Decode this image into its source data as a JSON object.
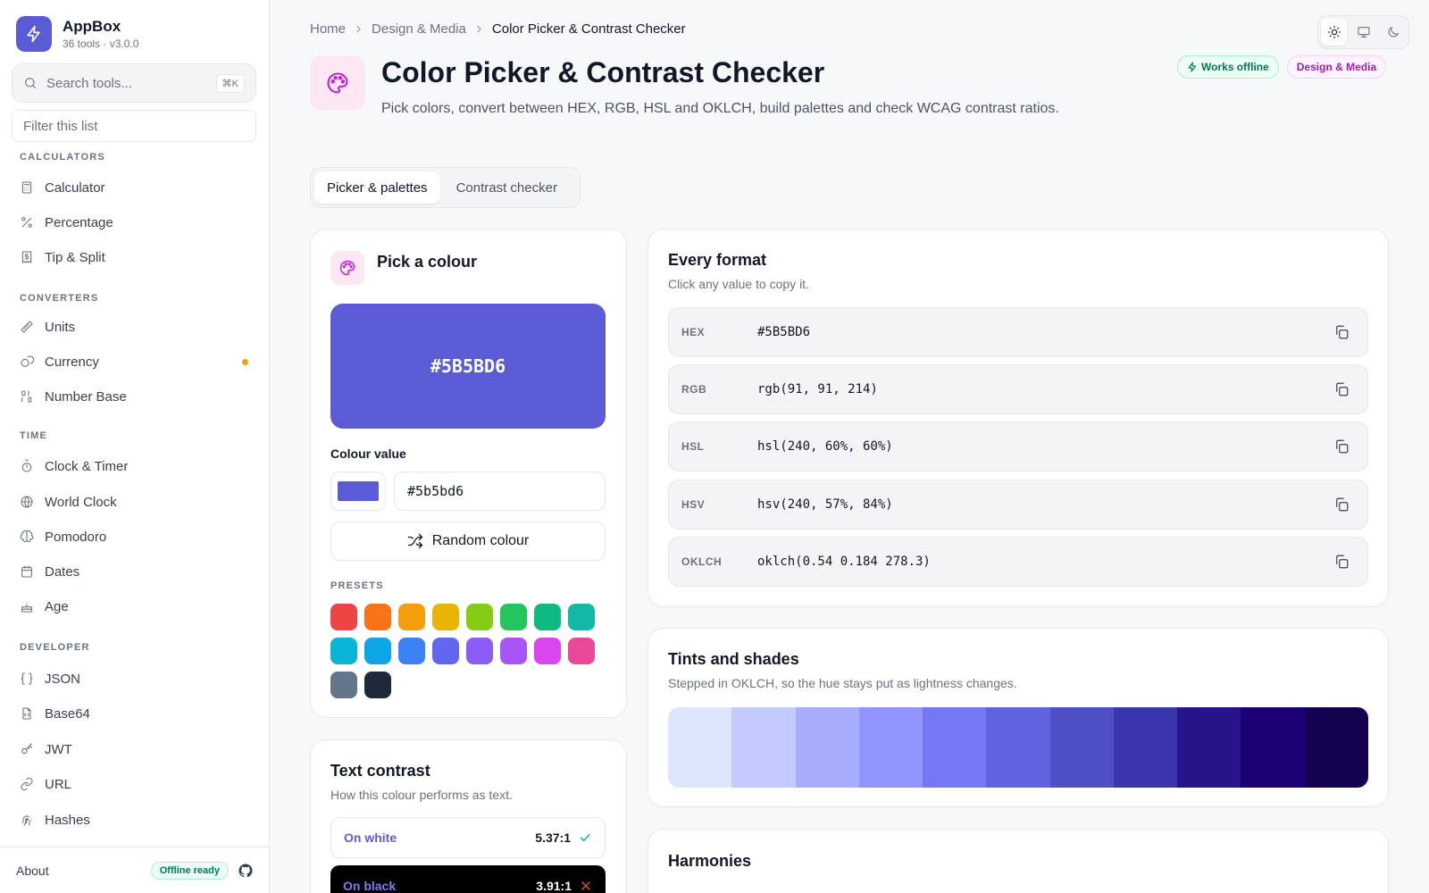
{
  "app": {
    "name": "AppBox",
    "subtitle": "36 tools · v3.0.0"
  },
  "search": {
    "placeholder": "Search tools...",
    "shortcut": "⌘K",
    "filter_placeholder": "Filter this list"
  },
  "nav": {
    "sections": [
      {
        "title": "CALCULATORS",
        "items": [
          {
            "label": "Calculator",
            "icon": "calculator-icon"
          },
          {
            "label": "Percentage",
            "icon": "percent-icon"
          },
          {
            "label": "Tip & Split",
            "icon": "receipt-icon"
          }
        ]
      },
      {
        "title": "CONVERTERS",
        "items": [
          {
            "label": "Units",
            "icon": "ruler-icon"
          },
          {
            "label": "Currency",
            "icon": "coins-icon",
            "status_dot": "#f59e0b"
          },
          {
            "label": "Number Base",
            "icon": "binary-icon"
          }
        ]
      },
      {
        "title": "TIME",
        "items": [
          {
            "label": "Clock & Timer",
            "icon": "timer-icon"
          },
          {
            "label": "World Clock",
            "icon": "globe-icon"
          },
          {
            "label": "Pomodoro",
            "icon": "brain-icon"
          },
          {
            "label": "Dates",
            "icon": "calendar-icon"
          },
          {
            "label": "Age",
            "icon": "cake-icon"
          }
        ]
      },
      {
        "title": "DEVELOPER",
        "items": [
          {
            "label": "JSON",
            "icon": "braces-icon"
          },
          {
            "label": "Base64",
            "icon": "file-code-icon"
          },
          {
            "label": "JWT",
            "icon": "key-icon"
          },
          {
            "label": "URL",
            "icon": "link-icon"
          },
          {
            "label": "Hashes",
            "icon": "fingerprint-icon"
          }
        ]
      }
    ]
  },
  "footer": {
    "about": "About",
    "offline_badge": "Offline ready",
    "icon": "github-icon"
  },
  "breadcrumb": [
    "Home",
    "Design & Media",
    "Color Picker & Contrast Checker"
  ],
  "theme": {
    "options": [
      "light",
      "system",
      "dark"
    ],
    "selected": "light"
  },
  "page": {
    "title": "Color Picker & Contrast Checker",
    "description": "Pick colors, convert between HEX, RGB, HSL and OKLCH, build palettes and check WCAG contrast ratios.",
    "badges": [
      "Works offline",
      "Design & Media"
    ]
  },
  "tabs": [
    "Picker & palettes",
    "Contrast checker"
  ],
  "picker": {
    "title": "Pick a colour",
    "swatch_hex": "#5B5BD6",
    "value_label": "Colour value",
    "input_value": "#5b5bd6",
    "random_label": "Random colour",
    "presets_label": "PRESETS",
    "presets": [
      "#ef4444",
      "#f97316",
      "#f59e0b",
      "#eab308",
      "#84cc16",
      "#22c55e",
      "#10b981",
      "#14b8a6",
      "#06b6d4",
      "#0ea5e9",
      "#3b82f6",
      "#6366f1",
      "#8b5cf6",
      "#a855f7",
      "#d946ef",
      "#ec4899",
      "#64748b",
      "#1e293b"
    ]
  },
  "formats": {
    "title": "Every format",
    "subtitle": "Click any value to copy it.",
    "rows": [
      {
        "key": "HEX",
        "value": "#5B5BD6"
      },
      {
        "key": "RGB",
        "value": "rgb(91, 91, 214)"
      },
      {
        "key": "HSL",
        "value": "hsl(240, 60%, 60%)"
      },
      {
        "key": "HSV",
        "value": "hsv(240, 57%, 84%)"
      },
      {
        "key": "OKLCH",
        "value": "oklch(0.54 0.184 278.3)"
      }
    ]
  },
  "shades": {
    "title": "Tints and shades",
    "subtitle": "Stepped in OKLCH, so the hue stays put as lightness changes.",
    "colors": [
      "#dde6fd",
      "#c3cafe",
      "#a7adfb",
      "#9194ff",
      "#7476f4",
      "#6162e0",
      "#4f4fc6",
      "#3b35ad",
      "#28148a",
      "#1c0075",
      "#13004f"
    ]
  },
  "contrast": {
    "title": "Text contrast",
    "subtitle": "How this colour performs as text.",
    "rows": [
      {
        "label": "On white",
        "ratio": "5.37:1",
        "pass": true
      },
      {
        "label": "On black",
        "ratio": "3.91:1",
        "pass": false
      }
    ]
  },
  "harmonies": {
    "title": "Harmonies"
  }
}
